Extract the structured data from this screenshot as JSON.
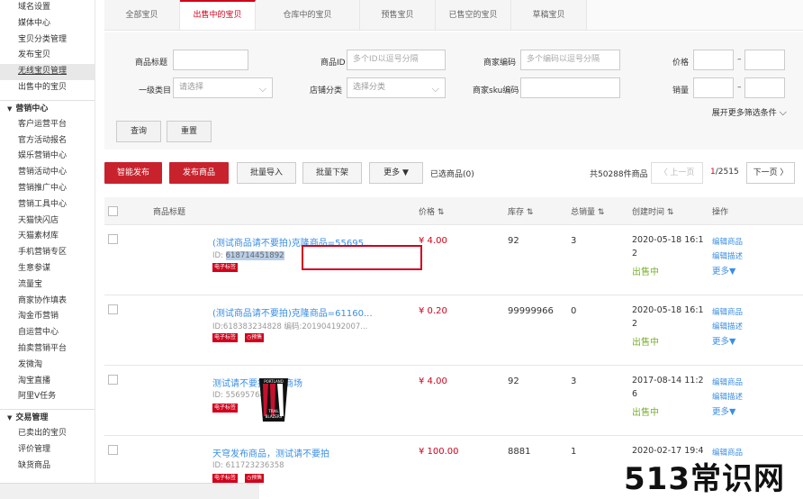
{
  "sidebar": {
    "items_top": [
      "域名设置",
      "媒体中心",
      "宝贝分类管理",
      "发布宝贝",
      "无线宝贝管理",
      "出售中的宝贝"
    ],
    "section_marketing": "营销中心",
    "items_marketing": [
      "客户运营平台",
      "官方活动报名",
      "娱乐营销中心",
      "营销活动中心",
      "营销推广中心",
      "营销工具中心",
      "天猫快闪店",
      "天猫素材库",
      "手机营销专区",
      "生意参谋",
      "流量宝",
      "商家协作填表",
      "淘金币营销",
      "自运营中心",
      "拍卖营销平台",
      "发微淘",
      "淘宝直播",
      "阿里V任务"
    ],
    "section_trade": "交易管理",
    "items_trade": [
      "已卖出的宝贝",
      "评价管理",
      "缺货商品"
    ]
  },
  "tabs": [
    "全部宝贝",
    "出售中的宝贝",
    "仓库中的宝贝",
    "预售宝贝",
    "已售空的宝贝",
    "草稿宝贝"
  ],
  "filters": {
    "title_label": "商品标题",
    "id_label": "商品ID",
    "id_placeholder": "多个ID以逗号分隔",
    "code_label": "商家编码",
    "code_placeholder": "多个编码以逗号分隔",
    "price_label": "价格",
    "category_label": "一级类目",
    "category_placeholder": "请选择",
    "shop_cat_label": "店铺分类",
    "shop_cat_placeholder": "选择分类",
    "sku_label": "商家sku编码",
    "sales_label": "销量",
    "dash": "–",
    "more_filters": "展开更多筛选条件",
    "query": "查询",
    "reset": "重置"
  },
  "toolbar": {
    "smart_publish": "智能发布",
    "publish": "发布商品",
    "batch_import": "批量导入",
    "batch_delist": "批量下架",
    "more": "更多",
    "selected": "已选商品(0)",
    "total": "共50288件商品",
    "prev": "〈 上一页",
    "page_current": "1",
    "page_total": "/2515",
    "next": "下一页 〉"
  },
  "table": {
    "headers": {
      "title": "商品标题",
      "price": "价格 ⇅",
      "stock": "库存 ⇅",
      "sales": "总销量 ⇅",
      "created": "创建时间 ⇅",
      "ops": "操作"
    },
    "rows": [
      {
        "title": "(测试商品请不要拍)克隆商品=55695...",
        "id_prefix": "ID: ",
        "id_value": "618714451892",
        "tags": [
          "电子标签"
        ],
        "price": "¥ 4.00",
        "stock": "92",
        "sales": "3",
        "created": "2020-05-18 16:12",
        "status": "出售中",
        "op_edit": "编辑商品",
        "op_desc": "编辑描述",
        "op_more": "更多"
      },
      {
        "title": "(测试商品请不要拍)克隆商品=61160...",
        "id_line": "ID:618383234828 编码:201904192007...",
        "tags": [
          "电子标签",
          "预售"
        ],
        "price": "¥ 0.20",
        "stock": "99999966",
        "sales": "0",
        "created": "2020-05-18 16:12",
        "status": "出售中",
        "op_edit": "编辑商品",
        "op_desc": "编辑描述",
        "op_more": "更多"
      },
      {
        "title": "测试请不要拍超时商场",
        "id_line": "ID: 556957640140",
        "tags": [
          "电子标签"
        ],
        "price": "¥ 4.00",
        "stock": "92",
        "sales": "3",
        "created": "2017-08-14 11:26",
        "status": "出售中",
        "op_edit": "编辑商品",
        "op_desc": "编辑描述",
        "op_more": "更多"
      },
      {
        "title": "天穹发布商品，测试请不要拍",
        "id_line": "ID: 611723236358",
        "tags": [
          "电子标签",
          "预售"
        ],
        "price": "¥ 100.00",
        "stock": "8881",
        "sales": "1",
        "created": "2020-02-17 19:4",
        "op_edit": "编辑商品"
      }
    ]
  },
  "watermark": "513常识网",
  "thumb_logo_text": [
    "PORTLAND",
    "TRAIL",
    "BLAZERS"
  ],
  "colors": {
    "accent_red": "#d0021b",
    "link_blue": "#3a8ee6",
    "status_green": "#7ab02e"
  }
}
